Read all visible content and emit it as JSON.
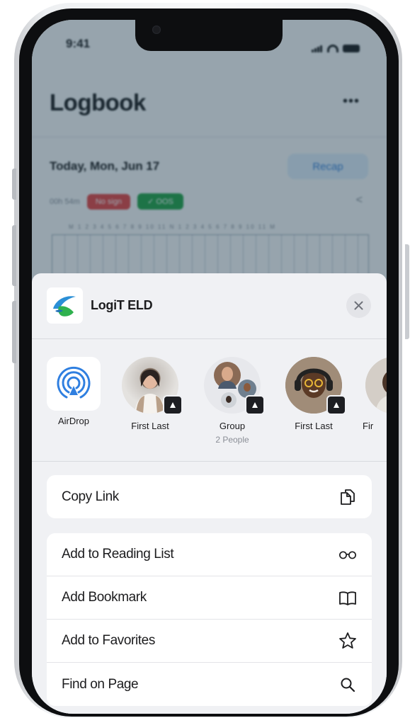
{
  "status_bar": {
    "time": "9:41"
  },
  "background_app": {
    "title": "Logbook",
    "more_label": "•••",
    "date": "Today, Mon, Jun 17",
    "recap_button": "Recap",
    "hours": "00h 54m",
    "badge_red": "No sign",
    "badge_green": "✓ OOS"
  },
  "share_sheet": {
    "app_name": "LogiT ELD",
    "close_icon": "close-icon",
    "targets": [
      {
        "label": "AirDrop",
        "icon": "airdrop-icon"
      },
      {
        "label": "First Last"
      },
      {
        "label": "Group",
        "sublabel": "2 People"
      },
      {
        "label": "First Last"
      },
      {
        "label": "Fir"
      }
    ],
    "actions_primary": [
      {
        "label": "Copy Link",
        "icon": "copy-icon"
      }
    ],
    "actions_secondary": [
      {
        "label": "Add to Reading List",
        "icon": "glasses-icon"
      },
      {
        "label": "Add Bookmark",
        "icon": "book-icon"
      },
      {
        "label": "Add to Favorites",
        "icon": "star-icon"
      },
      {
        "label": "Find on Page",
        "icon": "search-icon"
      }
    ]
  },
  "colors": {
    "logo_blue": "#2b8fd6",
    "logo_green": "#2fb14e",
    "airdrop_blue": "#2f7fe0",
    "recap_blue": "#3b82d6"
  }
}
